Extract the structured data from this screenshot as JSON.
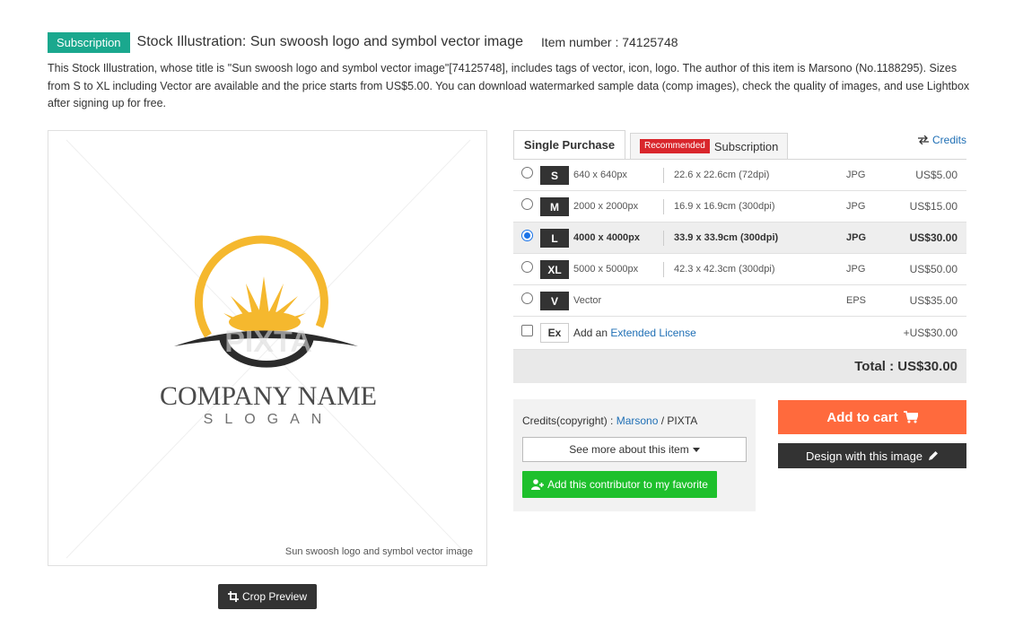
{
  "header": {
    "badge": "Subscription",
    "title": "Stock Illustration: Sun swoosh logo and symbol vector image",
    "item_number": "Item number : 74125748"
  },
  "description": "This Stock Illustration, whose title is \"Sun swoosh logo and symbol vector image\"[74125748], includes tags of vector, icon, logo. The author of this item is Marsono (No.1188295). Sizes from S to XL including Vector are available and the price starts from US$5.00. You can download watermarked sample data (comp images), check the quality of images, and use Lightbox after signing up for free.",
  "preview": {
    "company_name": "COMPANY NAME",
    "slogan": "SLOGAN",
    "watermark": "PIXTA",
    "caption": "Sun swoosh logo and symbol vector image",
    "crop_button": "Crop Preview",
    "sun_color": "#f5b82e",
    "swoosh_color": "#2b2b2b"
  },
  "tabs": {
    "single": "Single Purchase",
    "recommended_badge": "Recommended",
    "subscription": "Subscription",
    "credits": "Credits"
  },
  "sizes": [
    {
      "code": "S",
      "px": "640 x 640px",
      "cm": "22.6 x 22.6cm (72dpi)",
      "format": "JPG",
      "price": "US$5.00",
      "selected": false
    },
    {
      "code": "M",
      "px": "2000 x 2000px",
      "cm": "16.9 x 16.9cm (300dpi)",
      "format": "JPG",
      "price": "US$15.00",
      "selected": false
    },
    {
      "code": "L",
      "px": "4000 x 4000px",
      "cm": "33.9 x 33.9cm (300dpi)",
      "format": "JPG",
      "price": "US$30.00",
      "selected": true
    },
    {
      "code": "XL",
      "px": "5000 x 5000px",
      "cm": "42.3 x 42.3cm (300dpi)",
      "format": "JPG",
      "price": "US$50.00",
      "selected": false
    },
    {
      "code": "V",
      "px": "Vector",
      "cm": "",
      "format": "EPS",
      "price": "US$35.00",
      "selected": false
    }
  ],
  "extended": {
    "code": "Ex",
    "text_prefix": "Add an ",
    "link": "Extended License",
    "price": "+US$30.00"
  },
  "total": "Total : US$30.00",
  "credits_box": {
    "label": "Credits(copyright) : ",
    "author": "Marsono",
    "separator": " / ",
    "agency": "PIXTA",
    "see_more": "See more about this item",
    "favorite": "Add this contributor to my favorite"
  },
  "actions": {
    "add_to_cart": "Add to cart",
    "design": "Design with this image"
  },
  "colors": {
    "subscription_badge": "#1aa88e",
    "recommended_badge": "#d9262c",
    "cart_button": "#ff6a3d",
    "favorite_button": "#1ec02c",
    "link": "#1f6fb5"
  }
}
